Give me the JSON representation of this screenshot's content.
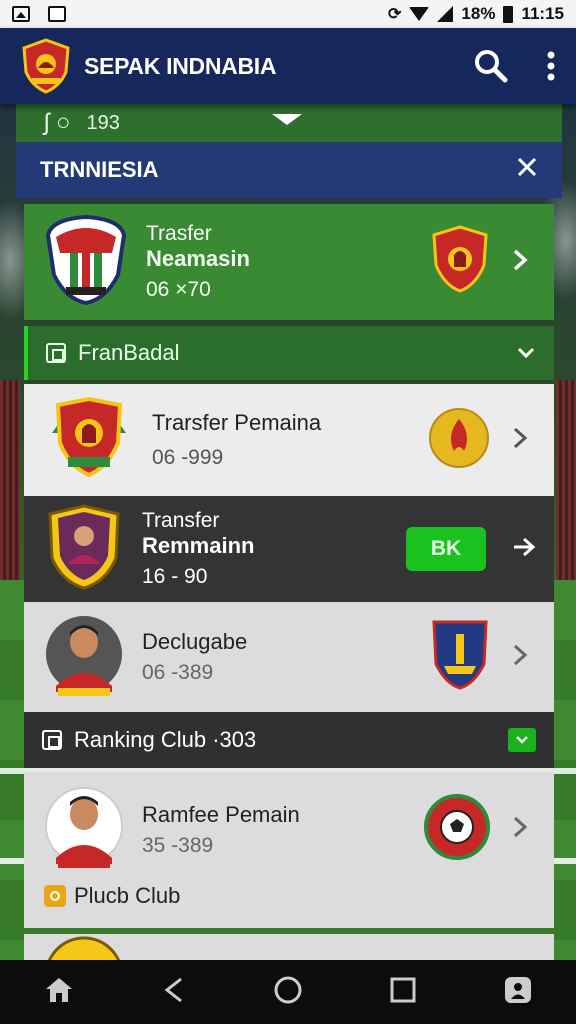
{
  "status_bar": {
    "battery_text": "18%",
    "time": "11:15"
  },
  "app_bar": {
    "title": "SEPAK INDNABIA"
  },
  "prev_strip": {
    "text": "193"
  },
  "section": {
    "title": "TRNNIESIA"
  },
  "featured": {
    "line1": "Trasfer",
    "line2": "Neamasin",
    "line3": "06 ×70"
  },
  "subsection_1": {
    "title": "FranBadal"
  },
  "cards": [
    {
      "title": "Trarsfer Pemaina",
      "value": "06 -999"
    },
    {
      "line1": "Transfer",
      "line2": "Remmainn",
      "value": "16 - 90",
      "badge": "BK"
    },
    {
      "title": "Declugabe",
      "value": "06 -389"
    }
  ],
  "subsection_2": {
    "title": "Ranking Club ·303"
  },
  "ranking_card": {
    "title": "Ramfee Pemain",
    "value": "35 -389",
    "footer": "Plucb Club"
  },
  "colors": {
    "app_bar": "#16275c",
    "section_head": "#223a78",
    "accent_green": "#19c21e",
    "card_green": "#3a8a34"
  },
  "icons": [
    "search-icon",
    "more-vert-icon",
    "close-icon",
    "chevron-right-icon",
    "chevron-down-icon",
    "home-icon",
    "back-icon",
    "circle-home-icon",
    "recents-icon",
    "assist-icon"
  ]
}
